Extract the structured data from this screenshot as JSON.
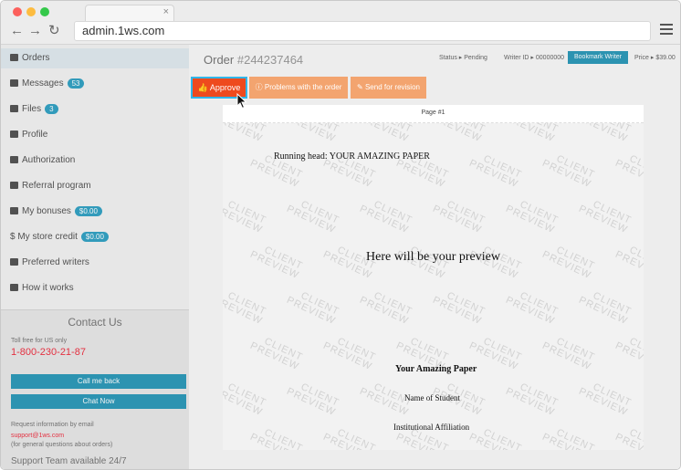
{
  "browser": {
    "url": "admin.1ws.com",
    "tab_close": "×",
    "back": "←",
    "forward": "→",
    "reload": "↻"
  },
  "sidebar": {
    "items": [
      {
        "label": "Orders",
        "icon": "list-icon",
        "badge": ""
      },
      {
        "label": "Messages",
        "icon": "envelope-icon",
        "badge": "53"
      },
      {
        "label": "Files",
        "icon": "file-icon",
        "badge": "3"
      },
      {
        "label": "Profile",
        "icon": "user-icon",
        "badge": ""
      },
      {
        "label": "Authorization",
        "icon": "lock-icon",
        "badge": ""
      },
      {
        "label": "Referral program",
        "icon": "gift-icon",
        "badge": ""
      },
      {
        "label": "My bonuses",
        "icon": "wallet-icon",
        "badge": "$0.00"
      },
      {
        "label": "$ My store credit",
        "icon": "dollar-icon",
        "badge": "$0.00"
      },
      {
        "label": "Preferred writers",
        "icon": "star-icon",
        "badge": ""
      },
      {
        "label": "How it works",
        "icon": "question-icon",
        "badge": ""
      }
    ],
    "contact": {
      "title": "Contact Us",
      "toll_free": "Toll free for US only",
      "phone": "1-800-230-21-87",
      "call_back": "Call me back",
      "chat": "Chat Now",
      "request_info": "Request information by email",
      "email": "support@1ws.com",
      "general": "(for general questions about orders)",
      "support": "Support Team available 24/7"
    }
  },
  "header": {
    "order_label": "Order",
    "order_number": "#244237464",
    "status": "Status ▸ Pending",
    "writer": "Writer ID ▸ 00000000",
    "bookmark": "Bookmark Writer",
    "price": "Price ▸ $39.00"
  },
  "actions": {
    "approve": "Approve",
    "problems": "Problems with the order",
    "revision": "Send for revision"
  },
  "preview": {
    "page_label": "Page #1",
    "running_head": "Running head:  YOUR AMAZING PAPER",
    "placeholder": "Here will be your preview",
    "paper_title": "Your Amazing Paper",
    "student": "Name of Student",
    "affiliation": "Institutional Affiliation",
    "watermark_top": "CLIENT",
    "watermark_bottom": "PREVIEW"
  },
  "colors": {
    "approve": "#ee4a1e",
    "accent": "#2e9ab9",
    "focus": "#2fb6ea"
  }
}
